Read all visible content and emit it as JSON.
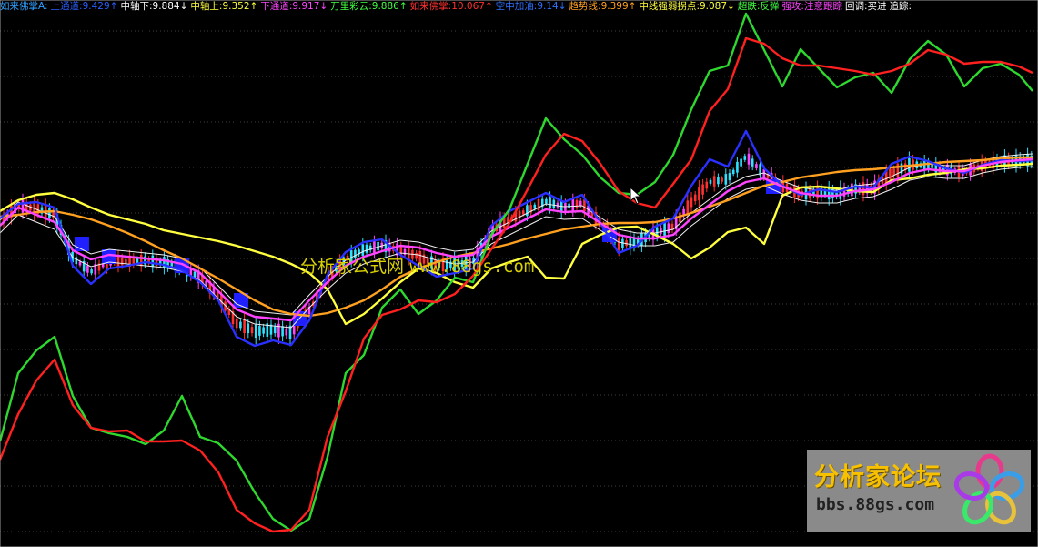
{
  "indicator_bar": [
    {
      "label": "如来佛掌A",
      "value": "",
      "arrow": "",
      "color": "#2fa0ff"
    },
    {
      "label": "上通道",
      "value": "9.429",
      "arrow": "↑",
      "color": "#2a5fff"
    },
    {
      "label": "中轴下",
      "value": "9.884",
      "arrow": "↓",
      "color": "#ffffff"
    },
    {
      "label": "中轴上",
      "value": "9.352",
      "arrow": "↑",
      "color": "#ffff40"
    },
    {
      "label": "下通道",
      "value": "9.917",
      "arrow": "↓",
      "color": "#ff44ff"
    },
    {
      "label": "万里彩云",
      "value": "9.886",
      "arrow": "↑",
      "color": "#40ff40"
    },
    {
      "label": "如来佛掌",
      "value": "10.067",
      "arrow": "↑",
      "color": "#ff3030"
    },
    {
      "label": "空中加油",
      "value": "9.14",
      "arrow": "↓",
      "color": "#3070ff"
    },
    {
      "label": "趋势线",
      "value": "9.399",
      "arrow": "↑",
      "color": "#ffa020"
    },
    {
      "label": "中线强弱拐点",
      "value": "9.087",
      "arrow": "↓",
      "color": "#ffff40"
    },
    {
      "label": "超跌",
      "value": "反弹",
      "arrow": "",
      "color": "#40ff40"
    },
    {
      "label": "强攻",
      "value": "注意跟踪",
      "arrow": "",
      "color": "#ff44ff"
    },
    {
      "label": "回调",
      "value": "买进",
      "arrow": "",
      "color": "#ffffff"
    },
    {
      "label": "追踪",
      "value": "",
      "arrow": "",
      "color": "#ffffff"
    }
  ],
  "watermark": {
    "center_cn": "分析家公式网",
    "center_url": "www.88gs.com",
    "logo_title": "分析家论坛",
    "logo_url": "bbs.88gs.com"
  },
  "chart_data": {
    "type": "line",
    "title": "",
    "xlabel": "",
    "ylabel": "",
    "grid": true,
    "x": [
      0,
      20,
      40,
      60,
      80,
      100,
      120,
      140,
      160,
      180,
      200,
      220,
      240,
      260,
      280,
      300,
      320,
      340,
      360,
      380,
      400,
      420,
      440,
      460,
      480,
      500,
      520,
      540,
      560,
      580,
      600,
      620,
      640,
      660,
      680,
      700,
      720,
      740,
      760,
      780,
      800,
      820,
      840,
      860,
      880,
      900,
      920,
      940,
      960,
      980,
      1000,
      1020,
      1040,
      1060,
      1080,
      1100,
      1120,
      1135
    ],
    "series": [
      {
        "name": "趋势线",
        "color": "#ffa020",
        "values": [
          238,
          236,
          233,
          232,
          236,
          241,
          248,
          256,
          265,
          275,
          284,
          295,
          306,
          318,
          330,
          340,
          345,
          347,
          344,
          338,
          330,
          318,
          304,
          295,
          288,
          282,
          278,
          273,
          268,
          262,
          257,
          252,
          249,
          246,
          245,
          245,
          244,
          240,
          234,
          227,
          220,
          212,
          204,
          200,
          195,
          192,
          189,
          187,
          186,
          184,
          182,
          180,
          178,
          177,
          176,
          174,
          173,
          173
        ]
      },
      {
        "name": "中线强弱拐点",
        "color": "#ffff40",
        "values": [
          232,
          220,
          214,
          212,
          219,
          228,
          236,
          241,
          246,
          253,
          257,
          261,
          265,
          270,
          276,
          282,
          290,
          300,
          318,
          356,
          345,
          328,
          310,
          295,
          300,
          310,
          316,
          295,
          288,
          282,
          305,
          306,
          268,
          258,
          250,
          249,
          258,
          268,
          284,
          272,
          255,
          250,
          268,
          215,
          206,
          205,
          207,
          210,
          211,
          198,
          196,
          192,
          190,
          186,
          185,
          182,
          181,
          180
        ]
      },
      {
        "name": "上通道",
        "color": "#2a30ff",
        "values": [
          240,
          224,
          222,
          228,
          292,
          312,
          295,
          292,
          288,
          291,
          297,
          310,
          330,
          370,
          380,
          374,
          379,
          352,
          302,
          277,
          266,
          263,
          280,
          292,
          304,
          300,
          295,
          248,
          232,
          222,
          212,
          222,
          214,
          245,
          278,
          270,
          249,
          240,
          204,
          175,
          183,
          144,
          185,
          204,
          214,
          208,
          211,
          205,
          206,
          180,
          172,
          177,
          185,
          190,
          181,
          176,
          177,
          176
        ]
      },
      {
        "name": "下通道",
        "color": "#ff44ff",
        "values": [
          248,
          228,
          236,
          244,
          275,
          285,
          280,
          282,
          284,
          286,
          290,
          300,
          320,
          340,
          348,
          350,
          352,
          330,
          310,
          292,
          282,
          276,
          270,
          272,
          278,
          282,
          280,
          260,
          250,
          240,
          230,
          233,
          232,
          245,
          258,
          262,
          262,
          258,
          240,
          225,
          210,
          200,
          196,
          205,
          212,
          215,
          215,
          210,
          208,
          200,
          190,
          186,
          188,
          188,
          182,
          178,
          176,
          175
        ]
      },
      {
        "name": "万里彩云",
        "color": "#2fd82f",
        "values": [
          485,
          410,
          385,
          370,
          435,
          470,
          476,
          480,
          488,
          473,
          435,
          480,
          487,
          506,
          541,
          570,
          583,
          570,
          502,
          410,
          390,
          338,
          318,
          345,
          330,
          305,
          310,
          258,
          230,
          180,
          130,
          153,
          170,
          195,
          212,
          214,
          200,
          170,
          120,
          78,
          72,
          15,
          55,
          95,
          54,
          75,
          96,
          85,
          80,
          102,
          65,
          45,
          60,
          95,
          75,
          70,
          82,
          100
        ]
      },
      {
        "name": "如来佛掌",
        "color": "#ff2020",
        "values": [
          505,
          455,
          418,
          395,
          445,
          470,
          474,
          473,
          485,
          485,
          484,
          495,
          519,
          560,
          575,
          584,
          582,
          560,
          480,
          430,
          372,
          346,
          340,
          330,
          332,
          323,
          303,
          274,
          245,
          208,
          170,
          147,
          155,
          180,
          210,
          223,
          228,
          202,
          175,
          122,
          98,
          42,
          48,
          64,
          72,
          72,
          75,
          78,
          82,
          78,
          70,
          55,
          60,
          70,
          68,
          68,
          73,
          80
        ]
      }
    ]
  }
}
